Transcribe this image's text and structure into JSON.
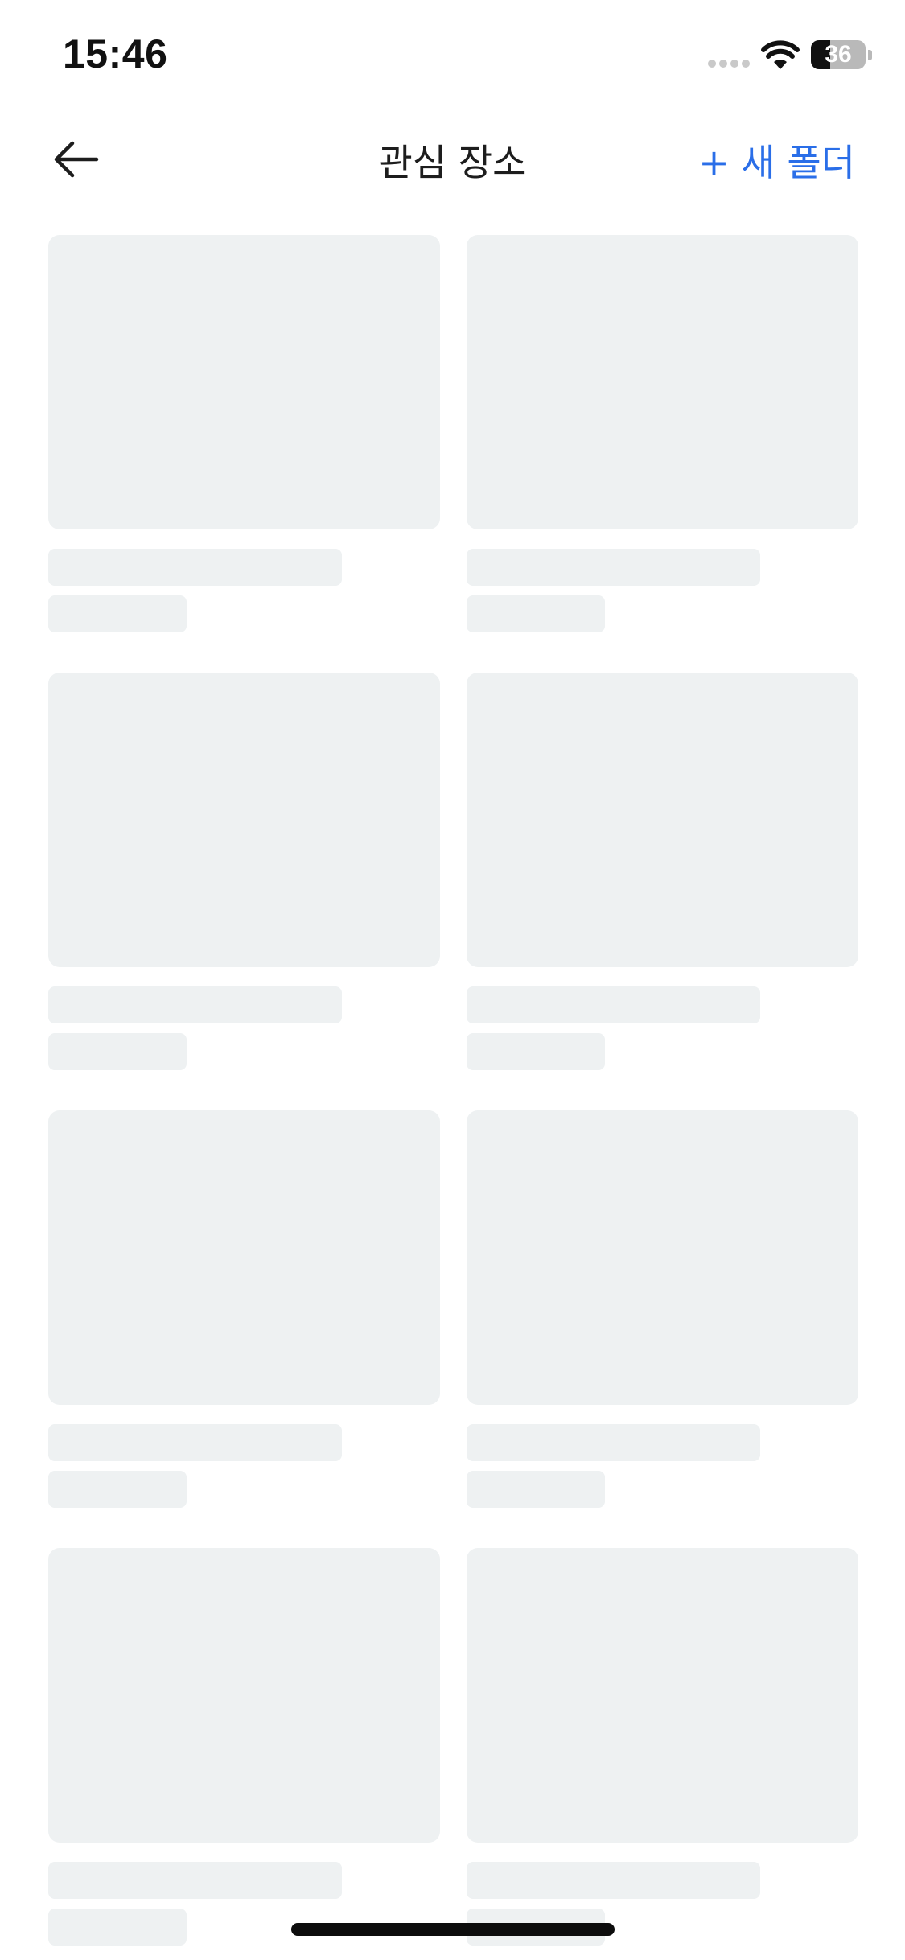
{
  "status_bar": {
    "time": "15:46",
    "battery_level": "36",
    "battery_percent": 36
  },
  "nav": {
    "title": "관심 장소",
    "new_folder_label": "+ 새 폴더",
    "back_icon": "arrow-left-icon"
  },
  "colors": {
    "accent": "#2a6ee8",
    "skeleton": "#eef1f2",
    "text": "#1d1d1d"
  },
  "grid": {
    "state": "loading",
    "placeholder_cards": 8
  }
}
